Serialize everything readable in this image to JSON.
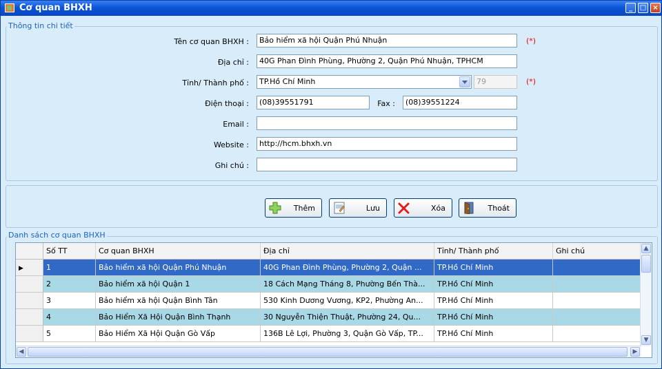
{
  "window": {
    "title": "Cơ quan BHXH"
  },
  "detail": {
    "group_title": "Thông tin chi tiết",
    "name_label": "Tên cơ quan BHXH :",
    "name_value": "Bảo hiểm xã hội Quận Phú Nhuận",
    "address_label": "Địa chỉ :",
    "address_value": "40G Phan Đình Phùng, Phường 2, Quận Phú Nhuận, TPHCM",
    "province_label": "Tỉnh/ Thành phố :",
    "province_value": "TP.Hồ Chí Minh",
    "province_code": "79",
    "required_mark": "(*)",
    "phone_label": "Điện thoại :",
    "phone_value": "(08)39551791",
    "fax_label": "Fax :",
    "fax_value": "(08)39551224",
    "email_label": "Email :",
    "email_value": "",
    "website_label": "Website :",
    "website_value": "http://hcm.bhxh.vn",
    "note_label": "Ghi chú :",
    "note_value": ""
  },
  "buttons": {
    "add": "Thêm",
    "save": "Lưu",
    "delete": "Xóa",
    "exit": "Thoát"
  },
  "list": {
    "group_title": "Danh sách cơ quan BHXH",
    "columns": [
      "Số TT",
      "Cơ quan BHXH",
      "Địa chỉ",
      "Tỉnh/ Thành phố",
      "Ghi chú"
    ],
    "rows": [
      [
        "1",
        "Bảo hiểm xã hội Quận Phú Nhuận",
        "40G Phan Đình Phùng, Phường 2, Quận ...",
        "TP.Hồ Chí Minh",
        ""
      ],
      [
        "2",
        "Bảo hiểm xã hội Quận 1",
        "18 Cách Mạng Tháng 8, Phường Bến Thà...",
        "TP.Hồ Chí Minh",
        ""
      ],
      [
        "3",
        "Bảo hiểm xã hội Quận Bình Tân",
        "530 Kinh Dương Vương, KP2, Phường An...",
        "TP.Hồ Chí Minh",
        ""
      ],
      [
        "4",
        "Bảo Hiểm Xã Hội Quận Bình Thạnh",
        "30 Nguyễn Thiện Thuật, Phường 24, Qu...",
        "TP.Hồ Chí Minh",
        ""
      ],
      [
        "5",
        "Bảo Hiểm Xã Hội Quận Gò Vấp",
        "136B Lê Lợi, Phường 3, Quận Gò Vấp, TP...",
        "TP.Hồ Chí Minh",
        ""
      ]
    ]
  },
  "colors": {
    "title_bar": "#0b55d8",
    "form_bg": "#d9ecf9",
    "selected_row": "#3169c6",
    "alt_row": "#a9d9e6",
    "required": "#ee0000"
  }
}
